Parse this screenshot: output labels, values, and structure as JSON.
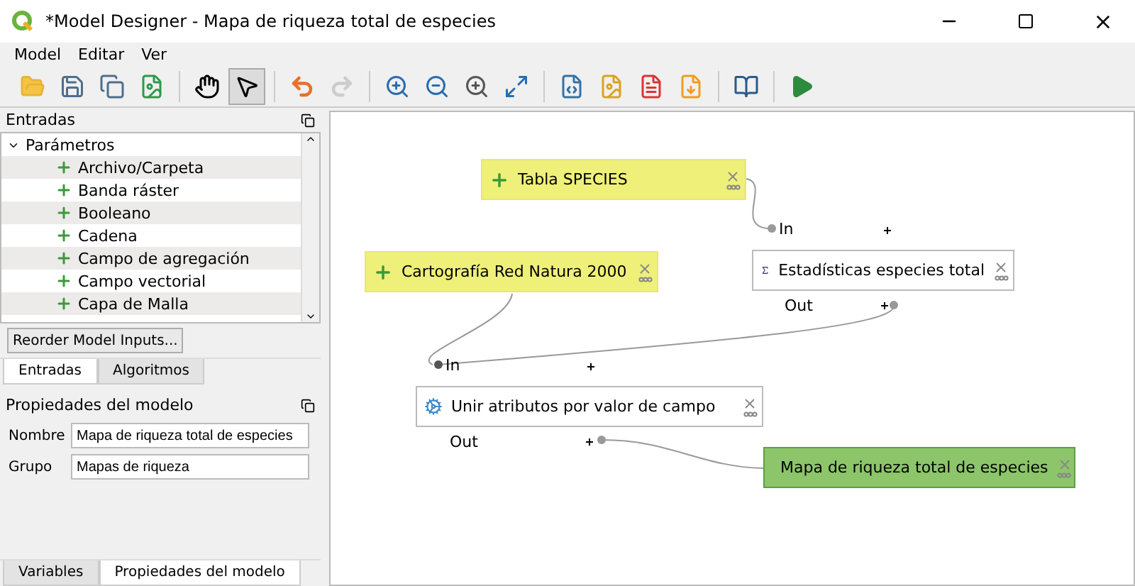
{
  "window": {
    "title": "*Model Designer - Mapa de riqueza total de especies"
  },
  "menu": [
    "Model",
    "Editar",
    "Ver"
  ],
  "tools": [
    {
      "selected": false
    },
    {
      "selected": true
    }
  ],
  "inputs_panel": {
    "title": "Entradas",
    "tree": {
      "label": "Parámetros",
      "expanded": true,
      "children": [
        {
          "label": "Archivo/Carpeta"
        },
        {
          "label": "Banda ráster"
        },
        {
          "label": "Booleano"
        },
        {
          "label": "Cadena"
        },
        {
          "label": "Campo de agregación"
        },
        {
          "label": "Campo vectorial"
        },
        {
          "label": "Capa de Malla"
        }
      ]
    },
    "button": "Reorder Model Inputs...",
    "tabs": [
      {
        "label": "Entradas",
        "selected": true
      },
      {
        "label": "Algoritmos",
        "selected": false
      }
    ]
  },
  "properties_panel": {
    "title": "Propiedades del modelo",
    "fields": [
      {
        "label": "Nombre",
        "value": "Mapa de riqueza total de especies"
      },
      {
        "label": "Grupo",
        "value": "Mapas de riqueza"
      }
    ],
    "tabs": [
      {
        "label": "Variables",
        "selected": false
      },
      {
        "label": "Propiedades del modelo",
        "selected": true
      }
    ]
  },
  "canvas": {
    "nodes": [
      {
        "kind": "input",
        "label": "Tabla SPECIES"
      },
      {
        "kind": "input",
        "label": "Cartografía Red Natura 2000"
      },
      {
        "kind": "algorithm",
        "label": "Estadísticas especies total",
        "in_label": "In",
        "out_label": "Out"
      },
      {
        "kind": "algorithm",
        "label": "Unir atributos por valor de campo",
        "in_label": "In",
        "out_label": "Out"
      },
      {
        "kind": "output",
        "label": "Mapa de riqueza total de especies"
      }
    ]
  }
}
